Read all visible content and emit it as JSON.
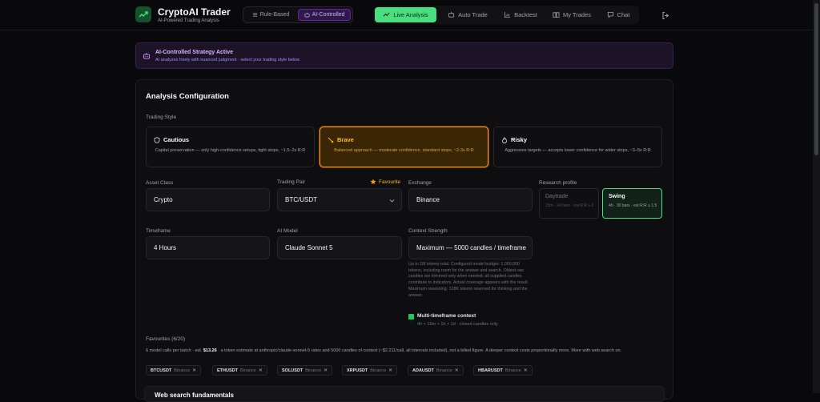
{
  "app": {
    "title": "CryptoAI Trader",
    "subtitle": "AI-Powered Trading Analysis"
  },
  "modes": [
    {
      "label": "Rule-Based",
      "active": false
    },
    {
      "label": "AI-Controlled",
      "active": true
    }
  ],
  "nav": [
    {
      "label": "Live Analysis",
      "icon": "trend-icon",
      "active": true
    },
    {
      "label": "Auto Trade",
      "icon": "bot-icon"
    },
    {
      "label": "Backtest",
      "icon": "chart-icon"
    },
    {
      "label": "My Trades",
      "icon": "book-icon"
    },
    {
      "label": "Chat",
      "icon": "chat-icon"
    }
  ],
  "banner": {
    "title": "AI-Controlled Strategy Active",
    "text": "AI analyzes freely with nuanced judgment · select your trading style below"
  },
  "config": {
    "heading": "Analysis Configuration",
    "style_label": "Trading Style",
    "styles": [
      {
        "name": "Cautious",
        "desc": "Capital preservation — only high-confidence setups, tight stops, ~1.5–2x R:R"
      },
      {
        "name": "Brave",
        "desc": "Balanced approach — moderate confidence, standard stops, ~2-3x R:R",
        "selected": true
      },
      {
        "name": "Risky",
        "desc": "Aggressive targets — accepts lower confidence for wider stops, ~3–5x R:R"
      }
    ],
    "asset_class": {
      "label": "Asset Class",
      "value": "Crypto"
    },
    "pair": {
      "label": "Trading Pair",
      "value": "BTC/USDT",
      "favourite": "Favourite"
    },
    "exchange": {
      "label": "Exchange",
      "value": "Binance"
    },
    "research": {
      "label": "Research profile",
      "options": [
        {
          "name": "Daytrade",
          "desc": "15m · 24 bars · est R:R ≥ 2"
        },
        {
          "name": "Swing",
          "desc": "4h · 30 bars · est R:R ≥ 1.5",
          "selected": true
        }
      ]
    },
    "timeframe": {
      "label": "Timeframe",
      "value": "4 Hours"
    },
    "model": {
      "label": "AI Model",
      "value": "Claude Sonnet 5"
    },
    "context": {
      "label": "Context Strength",
      "value": "Maximum — 5000 candles / timeframe",
      "note": "Up to 1M tokens total. Configured model budget: 1,000,000 tokens, including room for the answer and search. Oldest raw candles are trimmed only when needed; all supplied candles contribute to indicators. Actual coverage appears with the result. Maximum reasoning; 128K tokens reserved for thinking and the answer."
    },
    "mtf": {
      "label": "Multi-timeframe context",
      "desc": "4h + 15m + 1h + 1d · closed candles only",
      "checked": true
    },
    "favourites": {
      "label": "Favourites (6/20)",
      "cost_pre": "6 model calls per batch · est.",
      "cost_value": "$13.26",
      "cost_post": "· a token estimate at anthropic/claude-sonnet-5 rates and 5000 candles of context (~$2.211/call, all intervals included), not a billed figure. A deeper context costs proportionally more. More with web search on.",
      "items": [
        {
          "symbol": "BTCUSDT",
          "exchange": "Binance"
        },
        {
          "symbol": "ETHUSDT",
          "exchange": "Binance"
        },
        {
          "symbol": "SOLUSDT",
          "exchange": "Binance"
        },
        {
          "symbol": "XRPUSDT",
          "exchange": "Binance"
        },
        {
          "symbol": "ADAUSDT",
          "exchange": "Binance"
        },
        {
          "symbol": "HBARUSDT",
          "exchange": "Binance"
        }
      ]
    },
    "web_search": {
      "label": "Web search fundamentals"
    }
  },
  "colors": {
    "accent": "#4ade80",
    "purple": "#a78bfa",
    "amber": "#f59e0b"
  }
}
